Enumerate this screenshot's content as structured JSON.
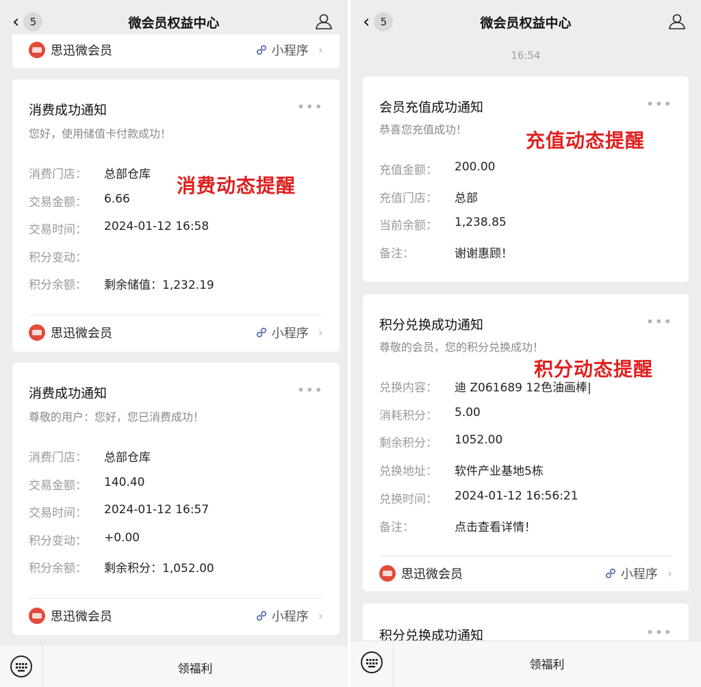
{
  "app": {
    "title": "微会员权益中心",
    "badge": "5",
    "brand": "思迅微会员",
    "mini_program": "小程序",
    "bottom_menu": "领福利"
  },
  "left": {
    "cards": [
      {
        "title": "消费成功通知",
        "subtitle": "您好，使用储值卡付款成功！",
        "rows": [
          {
            "label": "消费门店：",
            "value": "总部仓库"
          },
          {
            "label": "交易金额：",
            "value": "6.66"
          },
          {
            "label": "交易时间：",
            "value": "2024-01-12 16:58"
          },
          {
            "label": "积分变动：",
            "value": ""
          },
          {
            "label": "积分余额：",
            "value": "剩余储值：1,232.19"
          }
        ]
      },
      {
        "title": "消费成功通知",
        "subtitle": "尊敬的用户：您好，您已消费成功！",
        "rows": [
          {
            "label": "消费门店：",
            "value": "总部仓库"
          },
          {
            "label": "交易金额：",
            "value": "140.40"
          },
          {
            "label": "交易时间：",
            "value": "2024-01-12 16:57"
          },
          {
            "label": "积分变动：",
            "value": "+0.00"
          },
          {
            "label": "积分余额：",
            "value": "剩余积分：1,052.00"
          }
        ]
      }
    ],
    "annotation": "消费动态提醒"
  },
  "right": {
    "time": "16:54",
    "cards": [
      {
        "title": "会员充值成功通知",
        "subtitle": "恭喜您充值成功！",
        "rows": [
          {
            "label": "充值金额：",
            "value": "200.00"
          },
          {
            "label": "充值门店：",
            "value": "总部"
          },
          {
            "label": "当前余额：",
            "value": "1,238.85"
          },
          {
            "label": "备注：",
            "value": "谢谢惠顾！"
          }
        ]
      },
      {
        "title": "积分兑换成功通知",
        "subtitle": "尊敬的会员，您的积分兑换成功！",
        "rows": [
          {
            "label": "兑换内容：",
            "value": "迪 Z061689 12色油画棒|"
          },
          {
            "label": "消耗积分：",
            "value": "5.00"
          },
          {
            "label": "剩余积分：",
            "value": "1052.00"
          },
          {
            "label": "兑换地址：",
            "value": "软件产业基地5栋"
          },
          {
            "label": "兑换时间：",
            "value": "2024-01-12 16:56:21"
          },
          {
            "label": "备注：",
            "value": "点击查看详情！"
          }
        ]
      },
      {
        "title": "积分兑换成功通知"
      }
    ],
    "annotation_recharge": "充值动态提醒",
    "annotation_points": "积分动态提醒"
  },
  "colors": {
    "accent_red": "#e02020",
    "brand_red": "#e04b3a",
    "background": "#ededed"
  },
  "icons": [
    "back-chevron-icon",
    "person-icon",
    "more-dots-icon",
    "link-icon",
    "chevron-right-icon",
    "keyboard-icon",
    "brand-logo-icon"
  ]
}
